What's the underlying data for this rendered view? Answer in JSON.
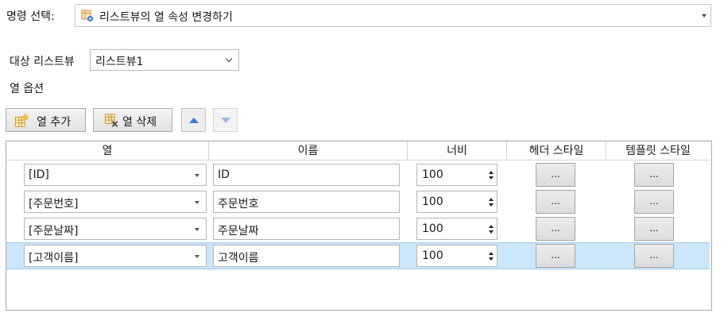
{
  "command": {
    "label": "명령 선택:",
    "value": "리스트뷰의 열 속성 변경하기",
    "icon": "listview-settings-icon"
  },
  "target": {
    "label": "대상 리스트뷰",
    "value": "리스트뷰1"
  },
  "options": {
    "label": "열 옵션"
  },
  "toolbar": {
    "add_label": "열 추가",
    "delete_label": "열 삭제",
    "add_icon": "grid-add-star-icon",
    "delete_icon": "grid-delete-x-icon",
    "up_icon": "move-up-arrow-icon",
    "down_icon": "move-down-arrow-icon"
  },
  "grid": {
    "headers": [
      "열",
      "이름",
      "너비",
      "헤더 스타일",
      "템플릿 스타일"
    ],
    "rows": [
      {
        "column": "[ID]",
        "name": "ID",
        "width": "100",
        "header_btn": "...",
        "template_btn": "...",
        "selected": false
      },
      {
        "column": "[주문번호]",
        "name": "주문번호",
        "width": "100",
        "header_btn": "...",
        "template_btn": "...",
        "selected": false
      },
      {
        "column": "[주문날짜]",
        "name": "주문날짜",
        "width": "100",
        "header_btn": "...",
        "template_btn": "...",
        "selected": false
      },
      {
        "column": "[고객이름]",
        "name": "고객이름",
        "width": "100",
        "header_btn": "...",
        "template_btn": "...",
        "selected": true
      }
    ]
  },
  "colors": {
    "selection": "#cce6fb",
    "accent": "#3d7bd6"
  }
}
